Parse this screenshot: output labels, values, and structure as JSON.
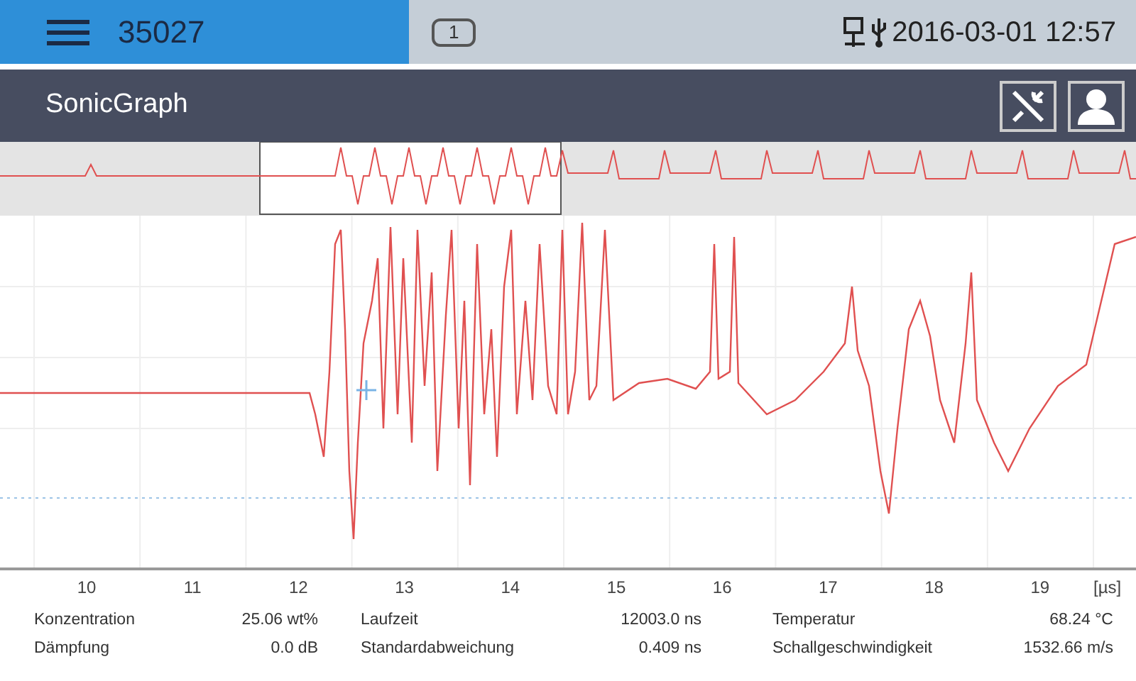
{
  "header": {
    "device_id": "35027",
    "page_badge": "1",
    "datetime": "2016-03-01 12:57"
  },
  "title_bar": {
    "title": "SonicGraph"
  },
  "chart": {
    "x_axis_labels": [
      "10",
      "11",
      "12",
      "13",
      "14",
      "15",
      "16",
      "17",
      "18",
      "19"
    ],
    "x_unit": "[µs]"
  },
  "readings": [
    {
      "label": "Konzentration",
      "value": "25.06 wt%"
    },
    {
      "label": "Dämpfung",
      "value": "0.0 dB"
    },
    {
      "label": "Laufzeit",
      "value": "12003.0 ns"
    },
    {
      "label": "Standardabweichung",
      "value": "0.409 ns"
    },
    {
      "label": "Temperatur",
      "value": "68.24 °C"
    },
    {
      "label": "Schallgeschwindigkeit",
      "value": "1532.66 m/s"
    }
  ]
}
